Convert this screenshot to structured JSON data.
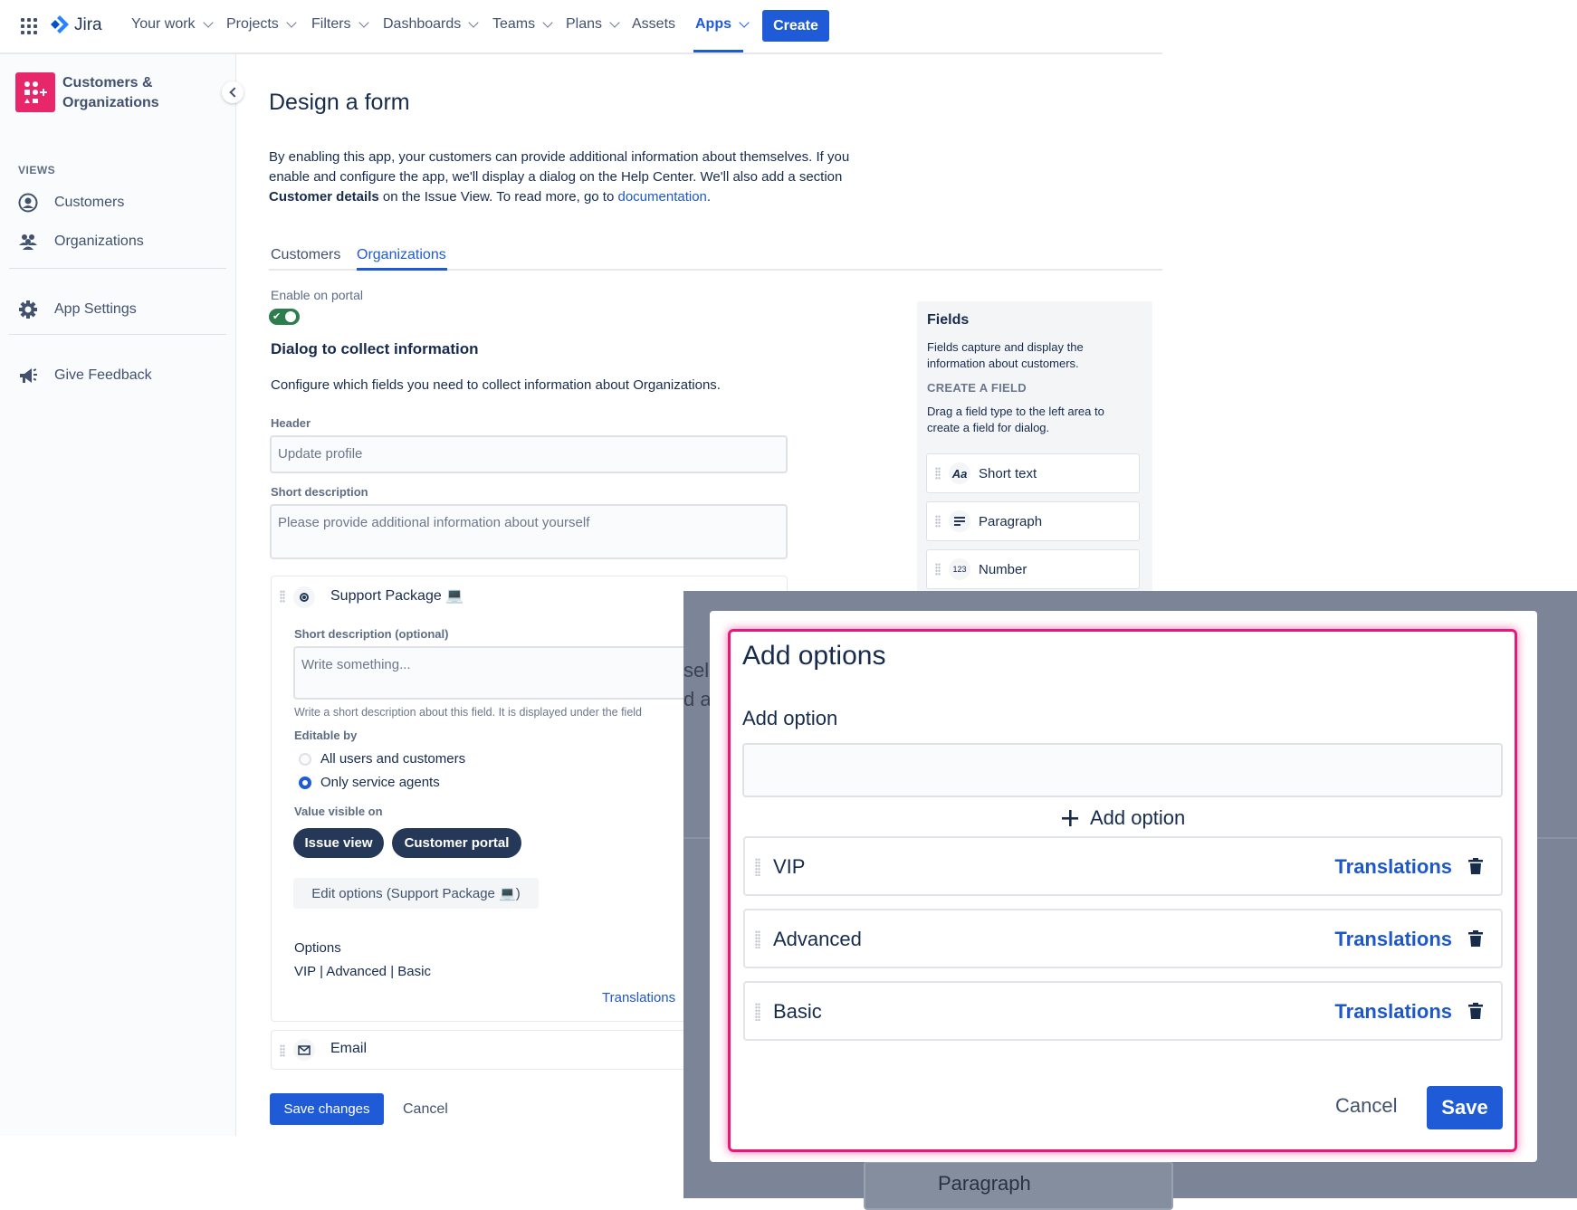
{
  "topnav": {
    "logo_text": "Jira",
    "items": [
      "Your work",
      "Projects",
      "Filters",
      "Dashboards",
      "Teams",
      "Plans",
      "Assets",
      "Apps"
    ],
    "create_label": "Create"
  },
  "sidebar": {
    "app_title_line1": "Customers &",
    "app_title_line2": "Organizations",
    "views_heading": "VIEWS",
    "items": [
      {
        "label": "Customers",
        "icon": "user-circle-icon"
      },
      {
        "label": "Organizations",
        "icon": "people-icon"
      },
      {
        "label": "App Settings",
        "icon": "gear-icon"
      },
      {
        "label": "Give Feedback",
        "icon": "megaphone-icon"
      }
    ]
  },
  "main": {
    "title": "Design a form",
    "intro_line1": "By enabling this app, your customers can provide additional information about themselves. If you",
    "intro_line2": "enable and configure the app, we'll display a dialog on the Help Center. We'll also add a section",
    "intro_bold": "Customer details",
    "intro_line3_rest": " on the Issue View. To read more, go to ",
    "intro_link": "documentation",
    "intro_end": ".",
    "tabs": [
      {
        "label": "Customers",
        "active": false
      },
      {
        "label": "Organizations",
        "active": true
      }
    ],
    "enable_label": "Enable on portal",
    "toggle_on": true,
    "dialog_heading": "Dialog to collect information",
    "dialog_desc": "Configure which fields you need to collect information about Organizations.",
    "header_label": "Header",
    "header_value": "Update profile",
    "short_desc_label": "Short description",
    "short_desc_value": "Please provide additional information about yourself",
    "field_card": {
      "name": "Support Package 💻",
      "short_desc_label": "Short description (optional)",
      "short_desc_placeholder": "Write something...",
      "helper": "Write a short description about this field. It is displayed under the field",
      "editable_label": "Editable by",
      "radio_options": [
        {
          "label": "All users and customers",
          "checked": false
        },
        {
          "label": "Only service agents",
          "checked": true
        }
      ],
      "visible_label": "Value visible on",
      "visible_pills": [
        "Issue view",
        "Customer portal"
      ],
      "edit_options_label": "Edit options (Support Package 💻)",
      "options_heading": "Options",
      "options_value": "VIP | Advanced | Basic",
      "translations_link": "Translations"
    },
    "email_field": "Email",
    "save_label": "Save changes",
    "cancel_label": "Cancel",
    "behind_text_1": "sel",
    "behind_text_2": "d a"
  },
  "fields_panel": {
    "title": "Fields",
    "desc": "Fields capture and display the information about customers.",
    "create_heading": "CREATE A FIELD",
    "create_desc": "Drag a field type to the left area to create a field for dialog.",
    "types": [
      {
        "label": "Short text",
        "icon": "Aa"
      },
      {
        "label": "Paragraph",
        "icon": "paragraph-icon"
      },
      {
        "label": "Number",
        "icon": "123"
      }
    ],
    "behind_label": "Paragraph"
  },
  "modal": {
    "title": "Add options",
    "add_label": "Add option",
    "add_value": "",
    "add_button": "Add option",
    "options": [
      "VIP",
      "Advanced",
      "Basic"
    ],
    "translations_label": "Translations",
    "cancel_label": "Cancel",
    "save_label": "Save"
  },
  "colors": {
    "accent": "#1f5bd6",
    "highlight": "#e6197a",
    "toggle": "#2e7d4f",
    "pill": "#253858"
  }
}
